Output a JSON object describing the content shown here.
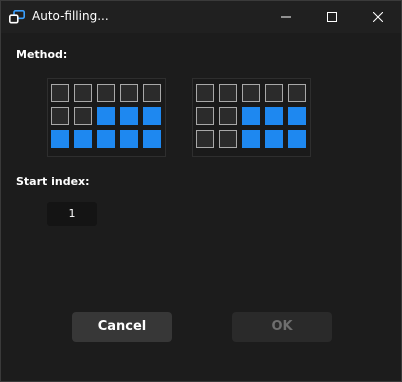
{
  "window": {
    "title": "Auto-filling...",
    "icons": {
      "app": "app-logo-icon",
      "minimize": "minimize-icon",
      "maximize": "maximize-icon",
      "close": "close-icon"
    }
  },
  "method": {
    "label": "Method:",
    "patterns": [
      {
        "name": "pattern-1",
        "rows": [
          [
            0,
            0,
            0,
            0,
            0
          ],
          [
            0,
            0,
            1,
            1,
            1
          ],
          [
            1,
            1,
            1,
            1,
            1
          ]
        ]
      },
      {
        "name": "pattern-2",
        "rows": [
          [
            0,
            0,
            0,
            0,
            0
          ],
          [
            0,
            0,
            1,
            1,
            1
          ],
          [
            0,
            0,
            1,
            1,
            1
          ]
        ]
      }
    ]
  },
  "start_index": {
    "label": "Start index:",
    "value": "1"
  },
  "buttons": {
    "cancel": "Cancel",
    "ok": "OK",
    "ok_enabled": false
  },
  "colors": {
    "accent": "#1e88f0",
    "background": "#1c1c1c"
  }
}
